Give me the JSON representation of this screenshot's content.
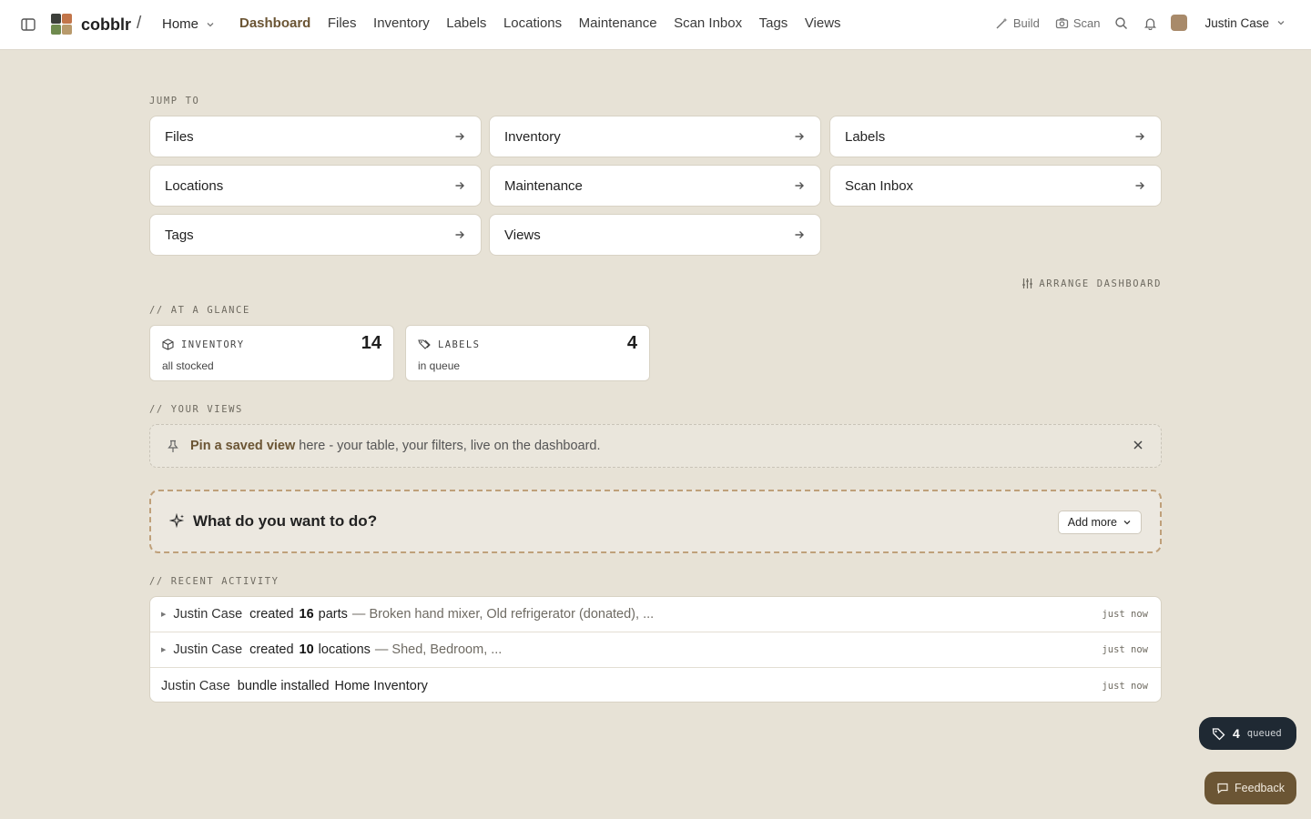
{
  "app": {
    "name": "cobblr",
    "workspace": "Home"
  },
  "nav": [
    "Dashboard",
    "Files",
    "Inventory",
    "Labels",
    "Locations",
    "Maintenance",
    "Scan Inbox",
    "Tags",
    "Views"
  ],
  "top_actions": {
    "build": "Build",
    "scan": "Scan",
    "user": "Justin Case"
  },
  "jump_to": {
    "label": "JUMP TO",
    "items": [
      "Files",
      "Inventory",
      "Labels",
      "Locations",
      "Maintenance",
      "Scan Inbox",
      "Tags",
      "Views"
    ]
  },
  "arrange_label": "ARRANGE DASHBOARD",
  "at_a_glance": {
    "label": "// AT A GLANCE",
    "cards": [
      {
        "title": "INVENTORY",
        "value": "14",
        "sub": "all stocked",
        "icon": "box-icon"
      },
      {
        "title": "LABELS",
        "value": "4",
        "sub": "in queue",
        "icon": "labels-icon"
      }
    ]
  },
  "your_views": {
    "label": "// YOUR VIEWS",
    "banner_link": "Pin a saved view",
    "banner_rest": "here - your table, your filters, live on the dashboard."
  },
  "wish": {
    "title": "What do you want to do?",
    "button": "Add more"
  },
  "recent": {
    "label": "// RECENT ACTIVITY",
    "rows": [
      {
        "actor": "Justin Case",
        "verb": "created",
        "count": "16",
        "noun": "parts",
        "detail": "— Broken hand mixer, Old refrigerator (donated), ...",
        "time": "just now"
      },
      {
        "actor": "Justin Case",
        "verb": "created",
        "count": "10",
        "noun": "locations",
        "detail": "— Shed, Bedroom, ...",
        "time": "just now"
      },
      {
        "actor": "Justin Case",
        "verb": "bundle installed",
        "noun": "Home Inventory",
        "time": "just now"
      }
    ]
  },
  "queued": {
    "count": "4",
    "label": "queued"
  },
  "feedback": "Feedback",
  "colors": {
    "background": "#e7e2d6",
    "accent": "#6b5534",
    "dark_pill": "#1f2933"
  }
}
